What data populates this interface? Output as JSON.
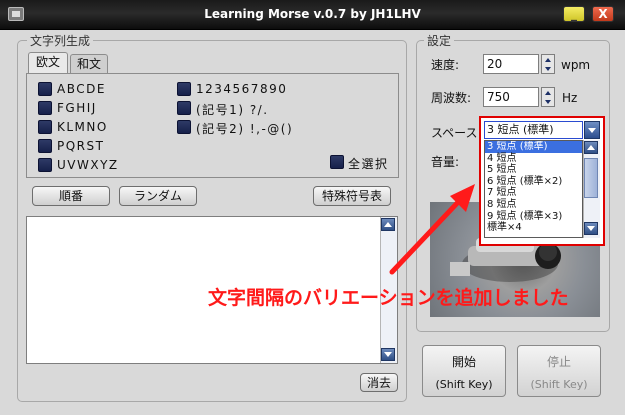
{
  "window": {
    "title": "Learning Morse v.0.7 by JH1LHV",
    "minimize_label": "_",
    "close_label": "X"
  },
  "generation": {
    "group_title": "文字列生成",
    "tabs": [
      {
        "label": "欧文",
        "active": true
      },
      {
        "label": "和文",
        "active": false
      }
    ],
    "checkboxes": [
      {
        "label": "ABCDE"
      },
      {
        "label": "FGHIJ"
      },
      {
        "label": "KLMNO"
      },
      {
        "label": "PQRST"
      },
      {
        "label": "UVWXYZ"
      },
      {
        "label": "1234567890"
      },
      {
        "label": "(記号1) ?/."
      },
      {
        "label": "(記号2) !,-@()"
      }
    ],
    "select_all_label": "全選択",
    "order_button": "順番",
    "random_button": "ランダム",
    "special_button": "特殊符号表",
    "output_text": "",
    "clear_button": "消去"
  },
  "settings": {
    "group_title": "設定",
    "speed": {
      "label": "速度:",
      "value": "20",
      "unit": "wpm"
    },
    "frequency": {
      "label": "周波数:",
      "value": "750",
      "unit": "Hz"
    },
    "space": {
      "label": "スペース",
      "selected": "3 短点 (標準)",
      "options": [
        {
          "label": "3 短点 (標準)",
          "selected": true
        },
        {
          "label": "4 短点",
          "selected": false
        },
        {
          "label": "5 短点",
          "selected": false
        },
        {
          "label": "6 短点 (標準×2)",
          "selected": false
        },
        {
          "label": "7 短点",
          "selected": false
        },
        {
          "label": "8 短点",
          "selected": false
        },
        {
          "label": "9 短点 (標準×3)",
          "selected": false
        },
        {
          "label": "標準×4",
          "selected": false
        }
      ]
    },
    "volume": {
      "label": "音量:"
    }
  },
  "start_button": {
    "label": "開始",
    "shortcut": "(Shift Key)"
  },
  "stop_button": {
    "label": "停止",
    "shortcut": "(Shift Key)",
    "disabled": true
  },
  "annotation": {
    "text": "文字間隔のバリエーションを追加しました",
    "color": "#ff1a1a"
  },
  "colors": {
    "highlight_border": "#e00000",
    "selected_option": "#3b6fe0",
    "checkbox": "#1e2a5a"
  }
}
